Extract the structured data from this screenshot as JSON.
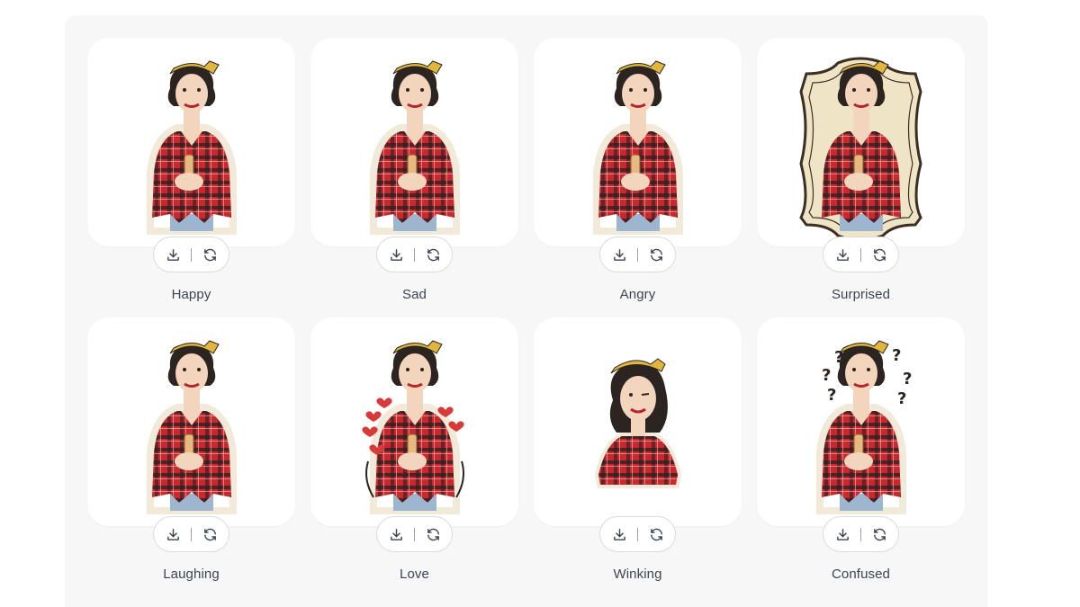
{
  "stickers": [
    {
      "label": "Happy",
      "variant": "plain"
    },
    {
      "label": "Sad",
      "variant": "plain"
    },
    {
      "label": "Angry",
      "variant": "plain"
    },
    {
      "label": "Surprised",
      "variant": "frame"
    },
    {
      "label": "Laughing",
      "variant": "plain"
    },
    {
      "label": "Love",
      "variant": "hearts"
    },
    {
      "label": "Winking",
      "variant": "bust"
    },
    {
      "label": "Confused",
      "variant": "question"
    }
  ],
  "icons": {
    "download": "download-icon",
    "regenerate": "refresh-icon"
  },
  "colors": {
    "panel": "#f7f7f7",
    "card": "#ffffff",
    "plaid_red": "#c8282e",
    "plaid_dark": "#2a1f1f",
    "bandana": "#e2b53c",
    "hair": "#2b2420",
    "skin": "#f3d4bd",
    "denim": "#9cb6cf",
    "sticker_edge": "#f2ead8",
    "frame_fill": "#f0e4c6",
    "frame_line": "#3b2e23"
  }
}
